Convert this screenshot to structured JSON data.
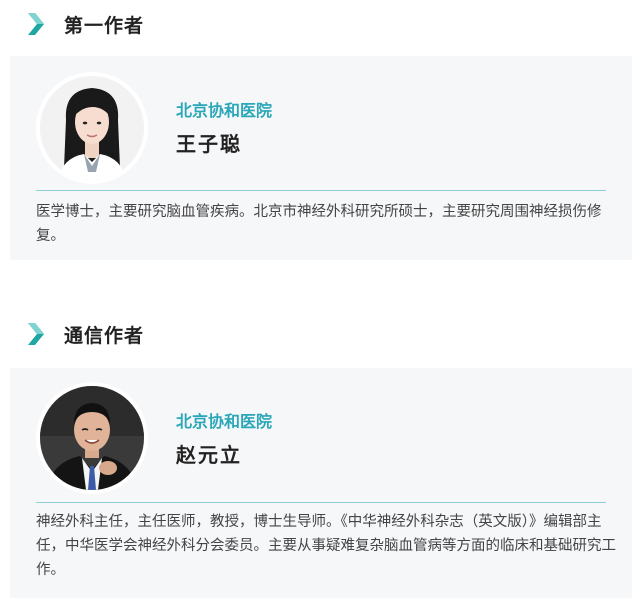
{
  "sections": [
    {
      "title": "第一作者",
      "hospital": "北京协和医院",
      "name": "王子聪",
      "bio": "医学博士，主要研究脑血管疾病。北京市神经外科研究所硕士，主要研究周围神经损伤修复。"
    },
    {
      "title": "通信作者",
      "hospital": "北京协和医院",
      "name": "赵元立",
      "bio": "神经外科主任，主任医师，教授，博士生导师。《中华神经外科杂志（英文版）》编辑部主任，中华医学会神经外科分会委员。主要从事疑难复杂脑血管病等方面的临床和基础研究工作。"
    }
  ],
  "colors": {
    "accent": "#2aa7b8",
    "chevron_light": "#7fd3d0",
    "chevron_dark": "#1fa6a3",
    "card_bg": "#f6f7f9",
    "divider": "#8fcdd6"
  },
  "icons": [
    "chevron-right-icon",
    "portrait-photo"
  ]
}
